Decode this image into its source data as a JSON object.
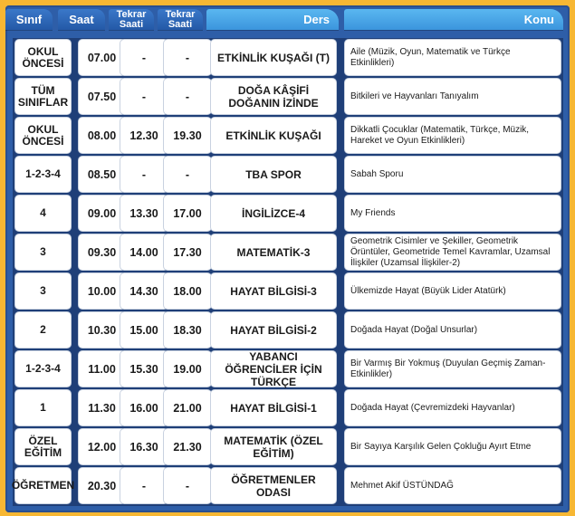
{
  "headers": {
    "sinif": "Sınıf",
    "saat": "Saat",
    "tekrar1": [
      "Tekrar",
      "Saati"
    ],
    "tekrar2": [
      "Tekrar",
      "Saati"
    ],
    "ders": "Ders",
    "konu": "Konu"
  },
  "rows": [
    {
      "sinif": "OKUL ÖNCESİ",
      "saat": "07.00",
      "tekrar1": "-",
      "tekrar2": "-",
      "ders": "ETKİNLİK KUŞAĞI (T)",
      "konu": "Aile (Müzik, Oyun, Matematik ve Türkçe Etkinlikleri)"
    },
    {
      "sinif": "TÜM SINIFLAR",
      "saat": "07.50",
      "tekrar1": "-",
      "tekrar2": "-",
      "ders": "DOĞA KÂŞİFİ DOĞANIN İZİNDE",
      "konu": "Bitkileri ve Hayvanları Tanıyalım"
    },
    {
      "sinif": "OKUL ÖNCESİ",
      "saat": "08.00",
      "tekrar1": "12.30",
      "tekrar2": "19.30",
      "ders": "ETKİNLİK KUŞAĞI",
      "konu": "Dikkatli Çocuklar (Matematik, Türkçe, Müzik, Hareket ve Oyun Etkinlikleri)"
    },
    {
      "sinif": "1-2-3-4",
      "saat": "08.50",
      "tekrar1": "-",
      "tekrar2": "-",
      "ders": "TBA SPOR",
      "konu": "Sabah Sporu"
    },
    {
      "sinif": "4",
      "saat": "09.00",
      "tekrar1": "13.30",
      "tekrar2": "17.00",
      "ders": "İNGİLİZCE-4",
      "konu": "My Friends"
    },
    {
      "sinif": "3",
      "saat": "09.30",
      "tekrar1": "14.00",
      "tekrar2": "17.30",
      "ders": "MATEMATİK-3",
      "konu": "Geometrik Cisimler ve Şekiller, Geometrik Örüntüler, Geometride Temel Kavramlar, Uzamsal İlişkiler (Uzamsal İlişkiler-2)"
    },
    {
      "sinif": "3",
      "saat": "10.00",
      "tekrar1": "14.30",
      "tekrar2": "18.00",
      "ders": "HAYAT BİLGİSİ-3",
      "konu": "Ülkemizde Hayat (Büyük Lider Atatürk)"
    },
    {
      "sinif": "2",
      "saat": "10.30",
      "tekrar1": "15.00",
      "tekrar2": "18.30",
      "ders": "HAYAT BİLGİSİ-2",
      "konu": "Doğada Hayat (Doğal Unsurlar)"
    },
    {
      "sinif": "1-2-3-4",
      "saat": "11.00",
      "tekrar1": "15.30",
      "tekrar2": "19.00",
      "ders": "YABANCI ÖĞRENCİLER İÇİN TÜRKÇE",
      "konu": "Bir Varmış Bir Yokmuş (Duyulan Geçmiş Zaman-Etkinlikler)"
    },
    {
      "sinif": "1",
      "saat": "11.30",
      "tekrar1": "16.00",
      "tekrar2": "21.00",
      "ders": "HAYAT BİLGİSİ-1",
      "konu": "Doğada Hayat (Çevremizdeki Hayvanlar)"
    },
    {
      "sinif": "ÖZEL EĞİTİM",
      "saat": "12.00",
      "tekrar1": "16.30",
      "tekrar2": "21.30",
      "ders": "MATEMATİK (ÖZEL EĞİTİM)",
      "konu": "Bir Sayıya Karşılık  Gelen Çokluğu Ayırt Etme"
    },
    {
      "sinif": "ÖĞRETMEN",
      "saat": "20.30",
      "tekrar1": "-",
      "tekrar2": "-",
      "ders": "ÖĞRETMENLER ODASI",
      "konu": "Mehmet Akif ÜSTÜNDAĞ"
    }
  ]
}
